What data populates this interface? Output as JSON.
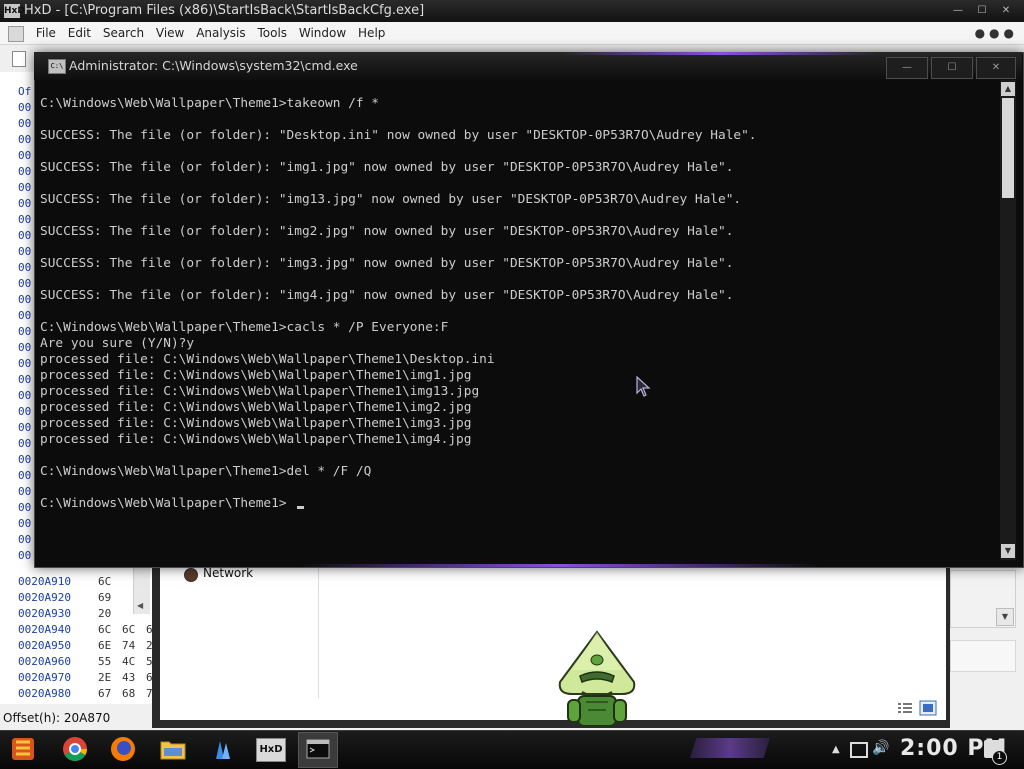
{
  "hxd": {
    "title": "HxD - [C:\\Program Files (x86)\\StartIsBack\\StartIsBackCfg.exe]",
    "app_icon_text": "HxD",
    "menu": [
      "File",
      "Edit",
      "Search",
      "View",
      "Analysis",
      "Tools",
      "Window",
      "Help"
    ],
    "offset_rows_partial": [
      "Of",
      "00",
      "00",
      "00",
      "00",
      "00",
      "00",
      "00",
      "00",
      "00",
      "00",
      "00",
      "00",
      "00",
      "00",
      "00",
      "00",
      "00",
      "00",
      "00",
      "00",
      "00",
      "00",
      "00",
      "00",
      "00",
      "00",
      "00",
      "00",
      "00"
    ],
    "offset_rows": [
      {
        "offset": "0020A910",
        "b1": "6C",
        "b2": "",
        "b3": ""
      },
      {
        "offset": "0020A920",
        "b1": "69",
        "b2": "",
        "b3": ""
      },
      {
        "offset": "0020A930",
        "b1": "20",
        "b2": "",
        "b3": ""
      },
      {
        "offset": "0020A940",
        "b1": "6C",
        "b2": "6C",
        "b3": "6"
      },
      {
        "offset": "0020A950",
        "b1": "6E",
        "b2": "74",
        "b3": "2"
      },
      {
        "offset": "0020A960",
        "b1": "55",
        "b2": "4C",
        "b3": "5"
      },
      {
        "offset": "0020A970",
        "b1": "2E",
        "b2": "43",
        "b3": "6"
      },
      {
        "offset": "0020A980",
        "b1": "67",
        "b2": "68",
        "b3": "7"
      }
    ],
    "status_offset": "Offset(h): 20A870"
  },
  "explorer": {
    "nav_item": "Network"
  },
  "cmd": {
    "title": "Administrator: C:\\Windows\\system32\\cmd.exe",
    "icon_text": "C:\\",
    "buttons": {
      "minimize": "—",
      "maximize": "☐",
      "close": "✕"
    },
    "lines": [
      {
        "text": "C:\\Windows\\Web\\Wallpaper\\Theme1>takeown /f *"
      },
      {
        "text": ""
      },
      {
        "text": "SUCCESS: The file (or folder): \"Desktop.ini\" now owned by user \"DESKTOP-0P53R7O\\Audrey Hale\"."
      },
      {
        "text": ""
      },
      {
        "text": "SUCCESS: The file (or folder): \"img1.jpg\" now owned by user \"DESKTOP-0P53R7O\\Audrey Hale\"."
      },
      {
        "text": ""
      },
      {
        "text": "SUCCESS: The file (or folder): \"img13.jpg\" now owned by user \"DESKTOP-0P53R7O\\Audrey Hale\"."
      },
      {
        "text": ""
      },
      {
        "text": "SUCCESS: The file (or folder): \"img2.jpg\" now owned by user \"DESKTOP-0P53R7O\\Audrey Hale\"."
      },
      {
        "text": ""
      },
      {
        "text": "SUCCESS: The file (or folder): \"img3.jpg\" now owned by user \"DESKTOP-0P53R7O\\Audrey Hale\"."
      },
      {
        "text": ""
      },
      {
        "text": "SUCCESS: The file (or folder): \"img4.jpg\" now owned by user \"DESKTOP-0P53R7O\\Audrey Hale\"."
      },
      {
        "text": ""
      },
      {
        "text": "C:\\Windows\\Web\\Wallpaper\\Theme1>cacls * /P Everyone:F"
      },
      {
        "text": "Are you sure (Y/N)?y"
      },
      {
        "text": "processed file: C:\\Windows\\Web\\Wallpaper\\Theme1\\Desktop.ini"
      },
      {
        "text": "processed file: C:\\Windows\\Web\\Wallpaper\\Theme1\\img1.jpg"
      },
      {
        "text": "processed file: C:\\Windows\\Web\\Wallpaper\\Theme1\\img13.jpg"
      },
      {
        "text": "processed file: C:\\Windows\\Web\\Wallpaper\\Theme1\\img2.jpg"
      },
      {
        "text": "processed file: C:\\Windows\\Web\\Wallpaper\\Theme1\\img3.jpg"
      },
      {
        "text": "processed file: C:\\Windows\\Web\\Wallpaper\\Theme1\\img4.jpg"
      },
      {
        "text": ""
      },
      {
        "text": "C:\\Windows\\Web\\Wallpaper\\Theme1>del * /F /Q"
      },
      {
        "text": ""
      },
      {
        "text": "C:\\Windows\\Web\\Wallpaper\\Theme1>"
      }
    ]
  },
  "taskbar": {
    "apps": [
      {
        "name": "start-button",
        "icon": "start-orb-icon"
      },
      {
        "name": "chrome",
        "icon": "chrome-icon"
      },
      {
        "name": "firefox",
        "icon": "firefox-icon"
      },
      {
        "name": "file-explorer",
        "icon": "folder-icon"
      },
      {
        "name": "app-4",
        "icon": "app-icon"
      },
      {
        "name": "hxd",
        "icon": "hxd-icon"
      },
      {
        "name": "cmd",
        "icon": "cmd-icon",
        "active": true
      }
    ],
    "hxd_icon_text": "HxD",
    "clock": "2:00 PM",
    "notification_count": "1"
  },
  "colors": {
    "console_bg": "#0c0c0c",
    "console_fg": "#cccccc",
    "accent": "#8a4fe0",
    "offset_blue": "#1a3ea8"
  }
}
